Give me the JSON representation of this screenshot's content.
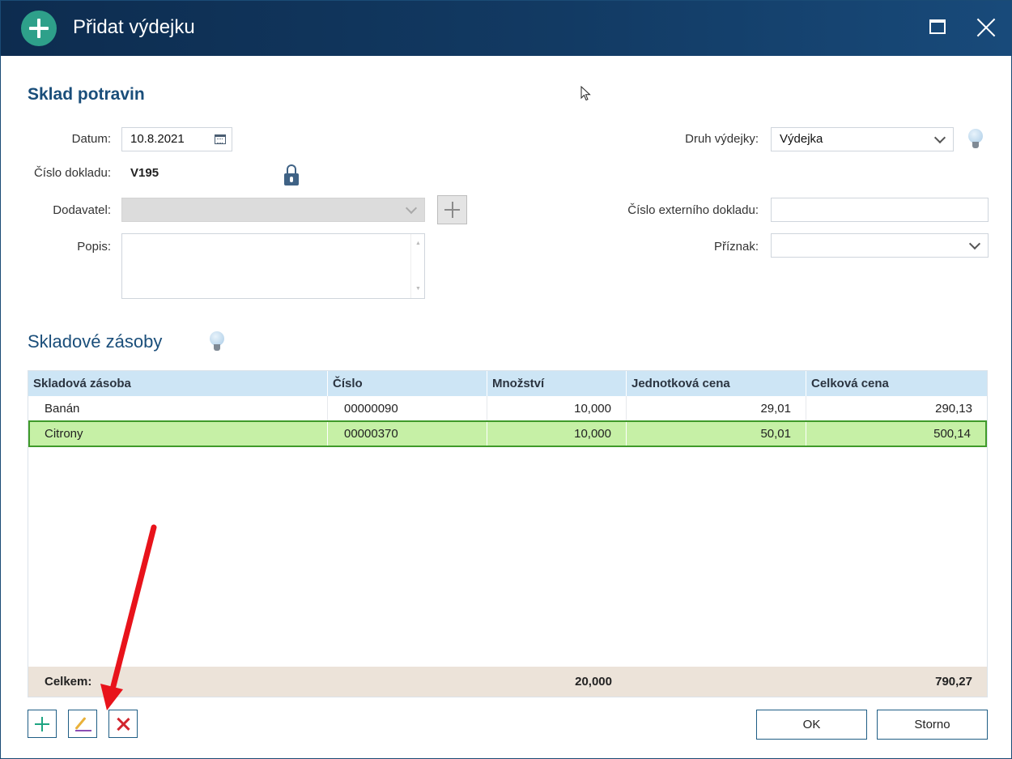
{
  "window": {
    "title": "Přidat výdejku"
  },
  "form": {
    "section_title": "Sklad potravin",
    "date_label": "Datum:",
    "date_value": "10.8.2021",
    "doc_number_label": "Číslo dokladu:",
    "doc_number_value": "V195",
    "supplier_label": "Dodavatel:",
    "supplier_value": "",
    "description_label": "Popis:",
    "description_value": "",
    "issue_type_label": "Druh výdejky:",
    "issue_type_value": "Výdejka",
    "external_doc_label": "Číslo externího dokladu:",
    "external_doc_value": "",
    "flag_label": "Příznak:",
    "flag_value": ""
  },
  "stock": {
    "section_title": "Skladové zásoby",
    "columns": [
      "Skladová zásoba",
      "Číslo",
      "Množství",
      "Jednotková cena",
      "Celková cena"
    ],
    "rows": [
      {
        "name": "Banán",
        "number": "00000090",
        "quantity": "10,000",
        "unit_price": "29,01",
        "total_price": "290,13",
        "selected": false
      },
      {
        "name": "Citrony",
        "number": "00000370",
        "quantity": "10,000",
        "unit_price": "50,01",
        "total_price": "500,14",
        "selected": true
      }
    ],
    "footer": {
      "label": "Celkem:",
      "quantity": "20,000",
      "total_price": "790,27"
    }
  },
  "buttons": {
    "ok": "OK",
    "cancel": "Storno"
  },
  "icons": {
    "title": "add-circle-icon",
    "calendar": "calendar-icon",
    "lock": "lock-icon",
    "hint": "lightbulb-icon",
    "add": "plus-icon",
    "edit": "pencil-icon",
    "delete": "x-icon"
  },
  "colors": {
    "titlebar": "#123a63",
    "accent_green": "#2ea08a",
    "selected_row": "#c6f0a6",
    "header_row": "#cde5f5",
    "footer_row": "#ece3d9",
    "annotation_arrow": "#e8131b"
  }
}
